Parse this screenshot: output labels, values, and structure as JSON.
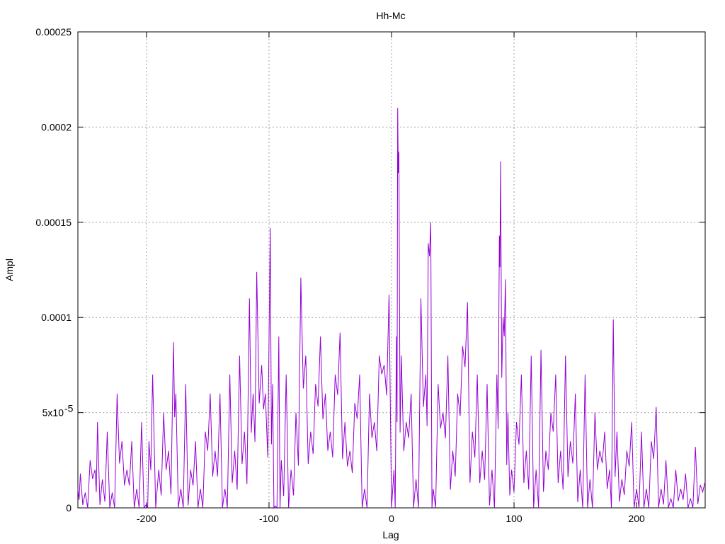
{
  "chart_data": {
    "type": "line",
    "title": "Hh-Mc",
    "xlabel": "Lag",
    "ylabel": "Ampl",
    "xlim": [
      -256,
      256
    ],
    "ylim": [
      0,
      0.00025
    ],
    "x_ticks": [
      -200,
      -100,
      0,
      100,
      200
    ],
    "x_tick_labels": [
      "-200",
      "-100",
      "0",
      "100",
      "200"
    ],
    "y_ticks": [
      0,
      5e-05,
      0.0001,
      0.00015,
      0.0002,
      0.00025
    ],
    "y_tick_labels": [
      "0",
      "5x10",
      "0.0001",
      "0.00015",
      "0.0002",
      "0.00025"
    ],
    "y_tick_exponent": "-5",
    "grid": true,
    "series": [
      {
        "color": "#9400d3",
        "peaks": [
          [
            -256,
            1e-05
          ],
          [
            -254,
            1.8e-05
          ],
          [
            -250,
            8e-06
          ],
          [
            -246,
            2.5e-05
          ],
          [
            -242,
            2e-05
          ],
          [
            -240,
            4.5e-05
          ],
          [
            -236,
            1.5e-05
          ],
          [
            -232,
            4e-05
          ],
          [
            -228,
            8e-06
          ],
          [
            -224,
            6e-05
          ],
          [
            -220,
            3.5e-05
          ],
          [
            -216,
            2e-05
          ],
          [
            -212,
            3.5e-05
          ],
          [
            -208,
            1e-05
          ],
          [
            -204,
            4.5e-05
          ],
          [
            -200,
            2e-06
          ],
          [
            -198,
            3.5e-05
          ],
          [
            -195,
            7e-05
          ],
          [
            -190,
            2e-05
          ],
          [
            -186,
            5e-05
          ],
          [
            -182,
            3e-05
          ],
          [
            -178,
            8.7e-05
          ],
          [
            -176,
            6e-05
          ],
          [
            -172,
            1e-05
          ],
          [
            -168,
            6.5e-05
          ],
          [
            -164,
            2e-05
          ],
          [
            -160,
            3.5e-05
          ],
          [
            -156,
            1e-05
          ],
          [
            -152,
            4e-05
          ],
          [
            -148,
            6e-05
          ],
          [
            -144,
            3e-05
          ],
          [
            -140,
            6e-05
          ],
          [
            -136,
            1e-05
          ],
          [
            -132,
            7e-05
          ],
          [
            -128,
            3e-05
          ],
          [
            -124,
            8e-05
          ],
          [
            -120,
            4e-05
          ],
          [
            -116,
            0.00011
          ],
          [
            -113,
            6e-05
          ],
          [
            -110,
            0.000124
          ],
          [
            -106,
            7.5e-05
          ],
          [
            -103,
            6e-05
          ],
          [
            -99,
            0.000147
          ],
          [
            -97,
            6.5e-05
          ],
          [
            -95,
            1e-06
          ],
          [
            -92,
            9e-05
          ],
          [
            -90,
            2.5e-05
          ],
          [
            -86,
            7e-05
          ],
          [
            -82,
            2e-05
          ],
          [
            -78,
            5e-05
          ],
          [
            -74,
            0.000121
          ],
          [
            -70,
            8e-05
          ],
          [
            -66,
            4e-05
          ],
          [
            -62,
            6.5e-05
          ],
          [
            -58,
            9e-05
          ],
          [
            -54,
            6e-05
          ],
          [
            -50,
            4e-05
          ],
          [
            -46,
            7e-05
          ],
          [
            -42,
            9.2e-05
          ],
          [
            -38,
            4.5e-05
          ],
          [
            -34,
            3e-05
          ],
          [
            -30,
            5.5e-05
          ],
          [
            -26,
            7e-05
          ],
          [
            -22,
            1e-05
          ],
          [
            -18,
            6e-05
          ],
          [
            -14,
            4.5e-05
          ],
          [
            -10,
            8e-05
          ],
          [
            -6,
            7.5e-05
          ],
          [
            -2,
            0.000112
          ],
          [
            2,
            2e-05
          ],
          [
            4,
            9e-05
          ],
          [
            5,
            0.00021
          ],
          [
            6,
            0.000187
          ],
          [
            8,
            8e-05
          ],
          [
            12,
            4.5e-05
          ],
          [
            16,
            6e-05
          ],
          [
            20,
            1.5e-05
          ],
          [
            24,
            0.00011
          ],
          [
            28,
            7e-05
          ],
          [
            30,
            0.000139
          ],
          [
            32,
            0.00015
          ],
          [
            34,
            1e-05
          ],
          [
            38,
            6.5e-05
          ],
          [
            42,
            5e-05
          ],
          [
            46,
            8e-05
          ],
          [
            50,
            3e-05
          ],
          [
            54,
            6e-05
          ],
          [
            58,
            8.5e-05
          ],
          [
            62,
            0.000108
          ],
          [
            66,
            4e-05
          ],
          [
            70,
            7e-05
          ],
          [
            74,
            3e-05
          ],
          [
            78,
            6.5e-05
          ],
          [
            82,
            2e-05
          ],
          [
            86,
            7e-05
          ],
          [
            88,
            0.000143
          ],
          [
            89,
            0.000182
          ],
          [
            91,
            0.0001
          ],
          [
            93,
            0.00012
          ],
          [
            95,
            5e-05
          ],
          [
            98,
            2e-05
          ],
          [
            102,
            4.5e-05
          ],
          [
            106,
            7e-05
          ],
          [
            110,
            3e-05
          ],
          [
            114,
            8e-05
          ],
          [
            118,
            2e-05
          ],
          [
            122,
            8.3e-05
          ],
          [
            126,
            3e-05
          ],
          [
            130,
            5e-05
          ],
          [
            134,
            7e-05
          ],
          [
            138,
            3e-05
          ],
          [
            142,
            8e-05
          ],
          [
            146,
            3.5e-05
          ],
          [
            150,
            6e-05
          ],
          [
            154,
            2e-05
          ],
          [
            158,
            7e-05
          ],
          [
            162,
            1.5e-05
          ],
          [
            166,
            5e-05
          ],
          [
            170,
            3e-05
          ],
          [
            174,
            4e-05
          ],
          [
            178,
            2e-05
          ],
          [
            181,
            9.9e-05
          ],
          [
            184,
            4e-05
          ],
          [
            188,
            1.5e-05
          ],
          [
            192,
            3e-05
          ],
          [
            196,
            4.5e-05
          ],
          [
            200,
            1e-05
          ],
          [
            204,
            4e-05
          ],
          [
            208,
            1e-05
          ],
          [
            212,
            3.5e-05
          ],
          [
            216,
            5.3e-05
          ],
          [
            220,
            1e-05
          ],
          [
            224,
            2.5e-05
          ],
          [
            228,
            5e-06
          ],
          [
            232,
            2e-05
          ],
          [
            236,
            1e-05
          ],
          [
            240,
            1.8e-05
          ],
          [
            244,
            5e-06
          ],
          [
            248,
            3.2e-05
          ],
          [
            252,
            1.2e-05
          ],
          [
            256,
            1.4e-05
          ]
        ]
      }
    ]
  }
}
